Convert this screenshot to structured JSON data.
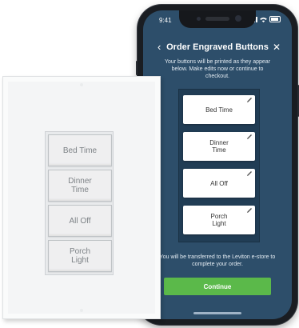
{
  "status_bar": {
    "time": "9:41"
  },
  "app": {
    "back_glyph": "‹",
    "title": "Order Engraved Buttons",
    "close_glyph": "✕",
    "subtitle": "Your buttons will be printed as they appear below. Make edits now or continue to checkout.",
    "buttons": [
      {
        "label": "Bed Time"
      },
      {
        "label": "Dinner\nTime"
      },
      {
        "label": "All Off"
      },
      {
        "label": "Porch\nLight"
      }
    ],
    "transfer_note": "You will be transferred to the Leviton e-store to complete your order.",
    "continue_label": "Continue"
  },
  "wall_switch": {
    "buttons": [
      {
        "label": "Bed Time"
      },
      {
        "label": "Dinner\nTime"
      },
      {
        "label": "All Off"
      },
      {
        "label": "Porch\nLight"
      }
    ]
  },
  "colors": {
    "app_background": "#2d4e6a",
    "panel": "#213d55",
    "continue_button": "#5bb94a"
  },
  "icons": [
    "back-icon",
    "close-icon",
    "edit-pencil-icon",
    "signal-icon",
    "wifi-icon",
    "battery-icon"
  ]
}
